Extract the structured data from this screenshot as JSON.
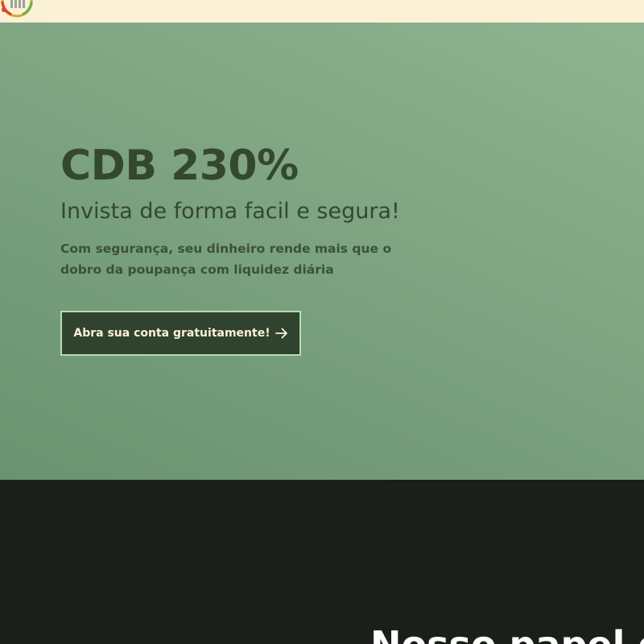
{
  "colors": {
    "topbar_bg": "#fbf1d7",
    "hero_bg_light": "#8db38f",
    "hero_bg_dark": "#6a9370",
    "hero_text": "#33482f",
    "cta_bg": "#2f432e",
    "cta_border": "#b6dcb2",
    "cta_text": "#fbf1d7",
    "dark_section_bg": "#1a1f19",
    "heading_text": "#ffffff"
  },
  "header": {
    "logo_icon": "logo-icon"
  },
  "hero": {
    "title": "CDB 230%",
    "subtitle": "Invista de forma facil e segura!",
    "description": "Com segurança, seu dinheiro rende mais que o dobro da poupança com liquidez diária",
    "cta_label": "Abra sua conta gratuitamente!",
    "cta_icon": "arrow-right-icon"
  },
  "section": {
    "heading": "Nosso papel é"
  }
}
